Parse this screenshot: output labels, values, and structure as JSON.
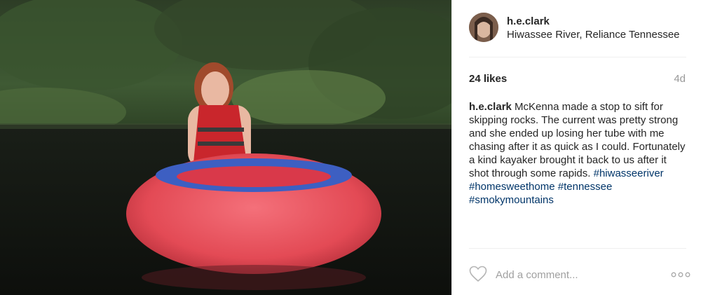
{
  "post": {
    "username": "h.e.clark",
    "location": "Hiwassee River, Reliance Tennessee",
    "likes": "24 likes",
    "time_ago": "4d",
    "caption": {
      "user": "h.e.clark",
      "text": "McKenna made a stop to sift for skipping rocks. The current was pretty strong and she ended up losing her tube with me chasing after it as quick as I could. Fortunately a kind kayaker brought it back to us after it shot through some rapids.",
      "hashtags": [
        "#hiwasseeriver",
        "#homesweethome",
        "#tennessee",
        "#smokymountains"
      ]
    },
    "comment": {
      "placeholder": "Add a comment..."
    }
  },
  "icons": {
    "like": "heart-outline-icon",
    "options": "three-dots-icon"
  },
  "colors": {
    "text": "#262626",
    "hashtag": "#003569",
    "muted": "#999999",
    "divider": "#efefef"
  }
}
